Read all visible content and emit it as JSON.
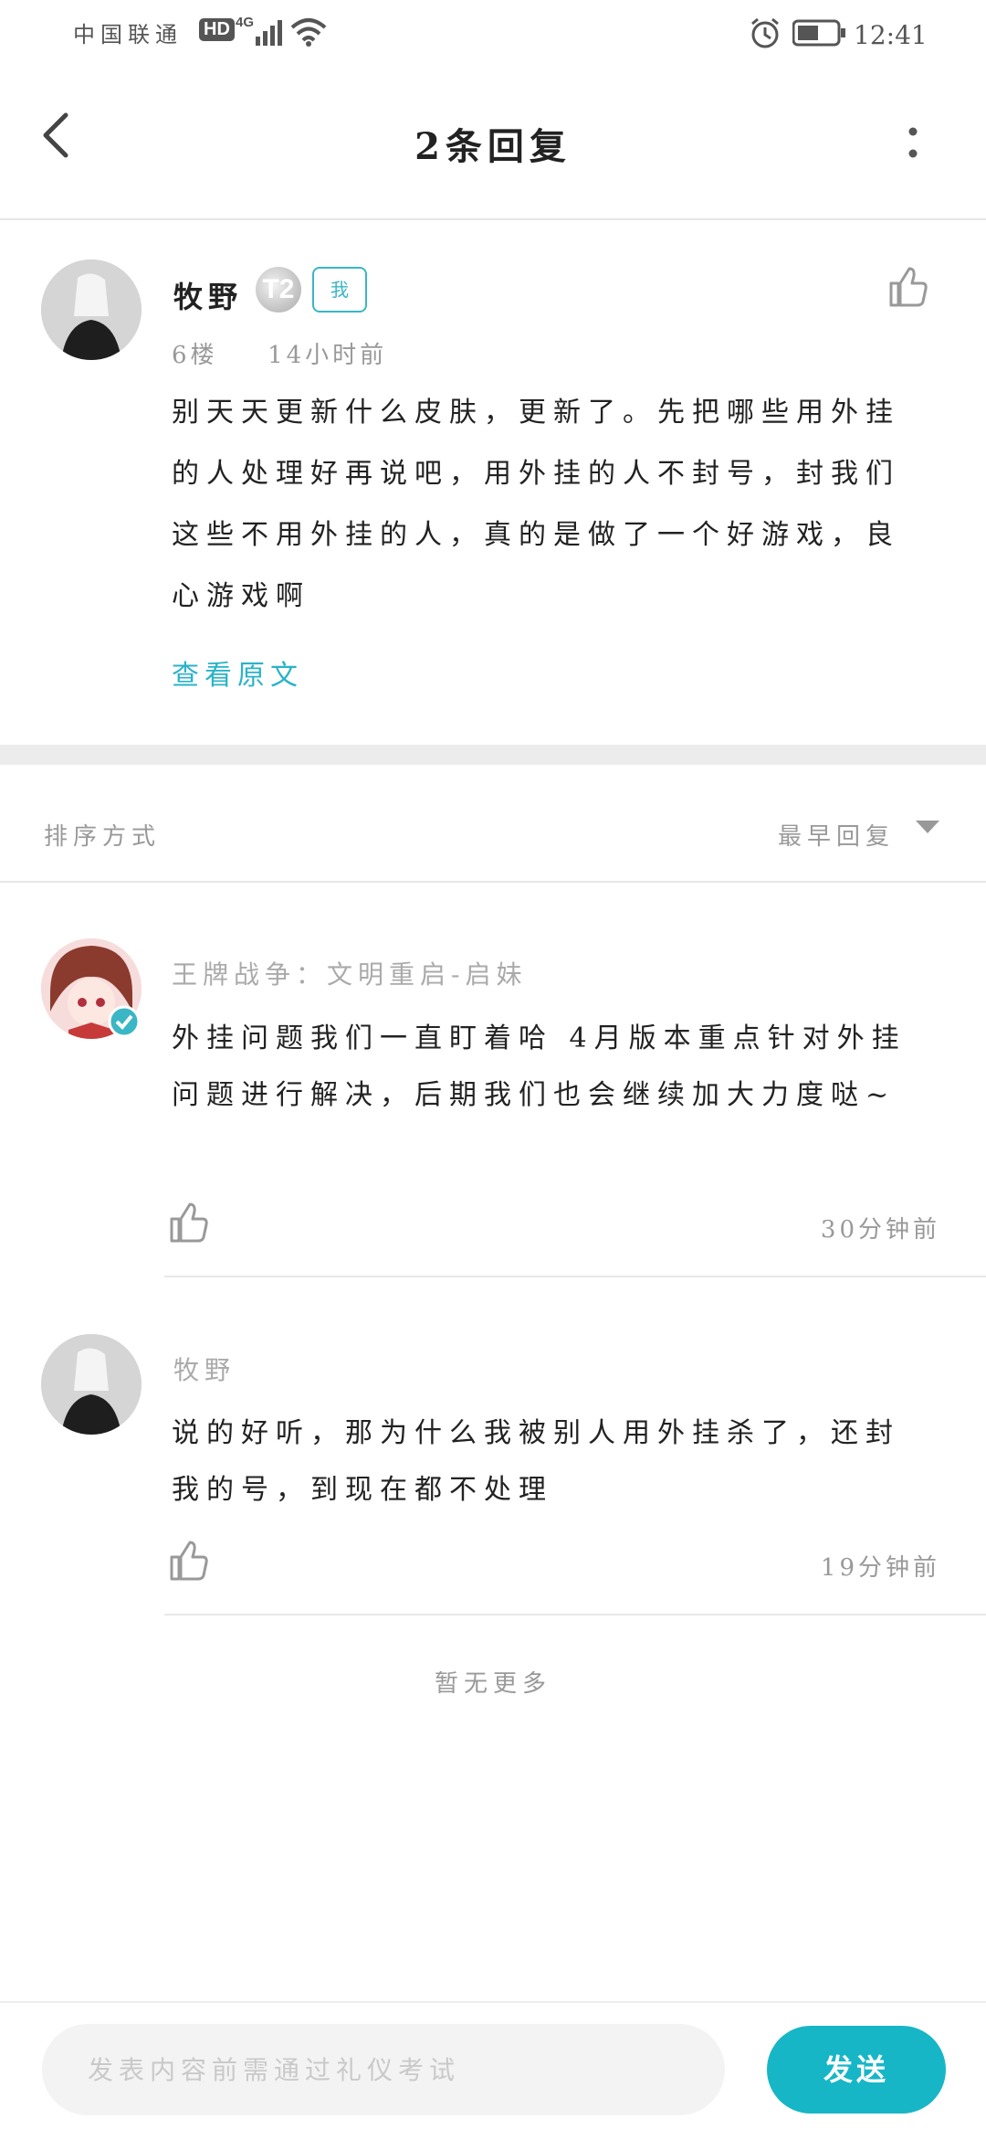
{
  "status_bar": {
    "carrier": "中国联通",
    "hd": "HD",
    "network": "4G",
    "time": "12:41"
  },
  "header": {
    "title": "2条回复"
  },
  "main_post": {
    "author": "牧野",
    "badge_level": "T2",
    "badge_me": "我",
    "floor": "6楼",
    "time": "14小时前",
    "body": "别天天更新什么皮肤，更新了。先把哪些用外挂的人处理好再说吧，用外挂的人不封号，封我们这些不用外挂的人，真的是做了一个好游戏，良心游戏啊",
    "view_original": "查看原文"
  },
  "sort": {
    "label": "排序方式",
    "value": "最早回复"
  },
  "replies": [
    {
      "author": "王牌战争：文明重启-启妹",
      "body": "外挂问题我们一直盯着哈 4月版本重点针对外挂问题进行解决，后期我们也会继续加大力度哒~",
      "time": "30分钟前"
    },
    {
      "author": "牧野",
      "body": "说的好听，那为什么我被别人用外挂杀了，还封我的号，到现在都不处理",
      "time": "19分钟前"
    }
  ],
  "no_more": "暂无更多",
  "footer": {
    "placeholder": "发表内容前需通过礼仪考试",
    "send_label": "发送"
  },
  "colors": {
    "accent": "#17b6c7",
    "link": "#2ab3c8",
    "muted": "#999999"
  }
}
